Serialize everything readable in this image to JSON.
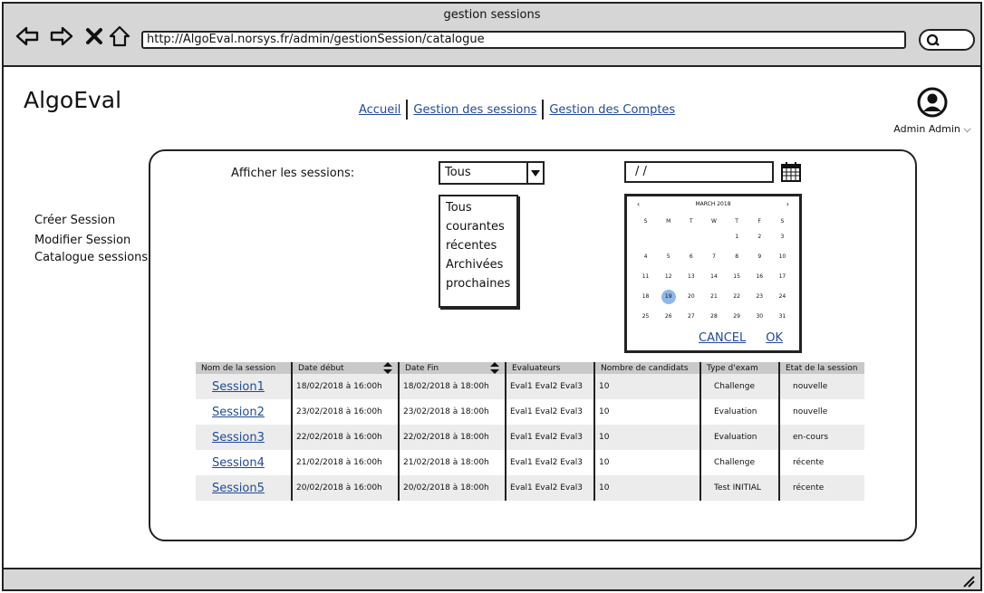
{
  "browser": {
    "title": "gestion sessions",
    "url": "http://AlgoEval.norsys.fr/admin/gestionSession/catalogue"
  },
  "app": {
    "logo": "AlgoEval",
    "nav": [
      "Accueil",
      "Gestion des sessions",
      "Gestion des Comptes"
    ],
    "user_label": "Admin Admin ⌵"
  },
  "sidebar": {
    "items": [
      "Créer Session",
      "Modifier Session",
      "Catalogue sessions"
    ]
  },
  "filter": {
    "label": "Afficher les sessions:",
    "selected": "Tous",
    "options": [
      "Tous",
      "courantes",
      "récentes",
      "Archivées",
      "prochaines"
    ],
    "date_value": "/ /"
  },
  "calendar": {
    "month": "MARCH 2018",
    "prev": "‹",
    "next": "›",
    "weekdays": [
      "S",
      "M",
      "T",
      "W",
      "T",
      "F",
      "S"
    ],
    "weeks": [
      [
        "",
        "",
        "",
        "",
        "1",
        "2",
        "3"
      ],
      [
        "4",
        "5",
        "6",
        "7",
        "8",
        "9",
        "10"
      ],
      [
        "11",
        "12",
        "13",
        "14",
        "15",
        "16",
        "17"
      ],
      [
        "18",
        "19",
        "20",
        "21",
        "22",
        "23",
        "24"
      ],
      [
        "25",
        "26",
        "27",
        "28",
        "29",
        "30",
        "31"
      ]
    ],
    "selected_day": "19",
    "cancel": "CANCEL",
    "ok": "OK"
  },
  "table": {
    "headers": [
      "Nom de la session",
      "Date début",
      "Date Fin",
      "Evaluateurs",
      "Nombre de candidats",
      "Type d'exam",
      "Etat de la session"
    ],
    "rows": [
      [
        "Session1",
        "18/02/2018 à 16:00h",
        "18/02/2018 à 18:00h",
        "Eval1 Eval2 Eval3",
        "10",
        "Challenge",
        "nouvelle"
      ],
      [
        "Session2",
        "23/02/2018 à 16:00h",
        "23/02/2018 à 18:00h",
        "Eval1 Eval2 Eval3",
        "10",
        "Evaluation",
        "nouvelle"
      ],
      [
        "Session3",
        "22/02/2018 à 16:00h",
        "22/02/2018 à 18:00h",
        "Eval1 Eval2 Eval3",
        "10",
        "Evaluation",
        "en-cours"
      ],
      [
        "Session4",
        "21/02/2018 à 16:00h",
        "21/02/2018 à 18:00h",
        "Eval1 Eval2 Eval3",
        "10",
        "Challenge",
        "récente"
      ],
      [
        "Session5",
        "20/02/2018 à 16:00h",
        "20/02/2018 à 18:00h",
        "Eval1 Eval2 Eval3",
        "10",
        "Test INITIAL",
        "récente"
      ]
    ]
  }
}
